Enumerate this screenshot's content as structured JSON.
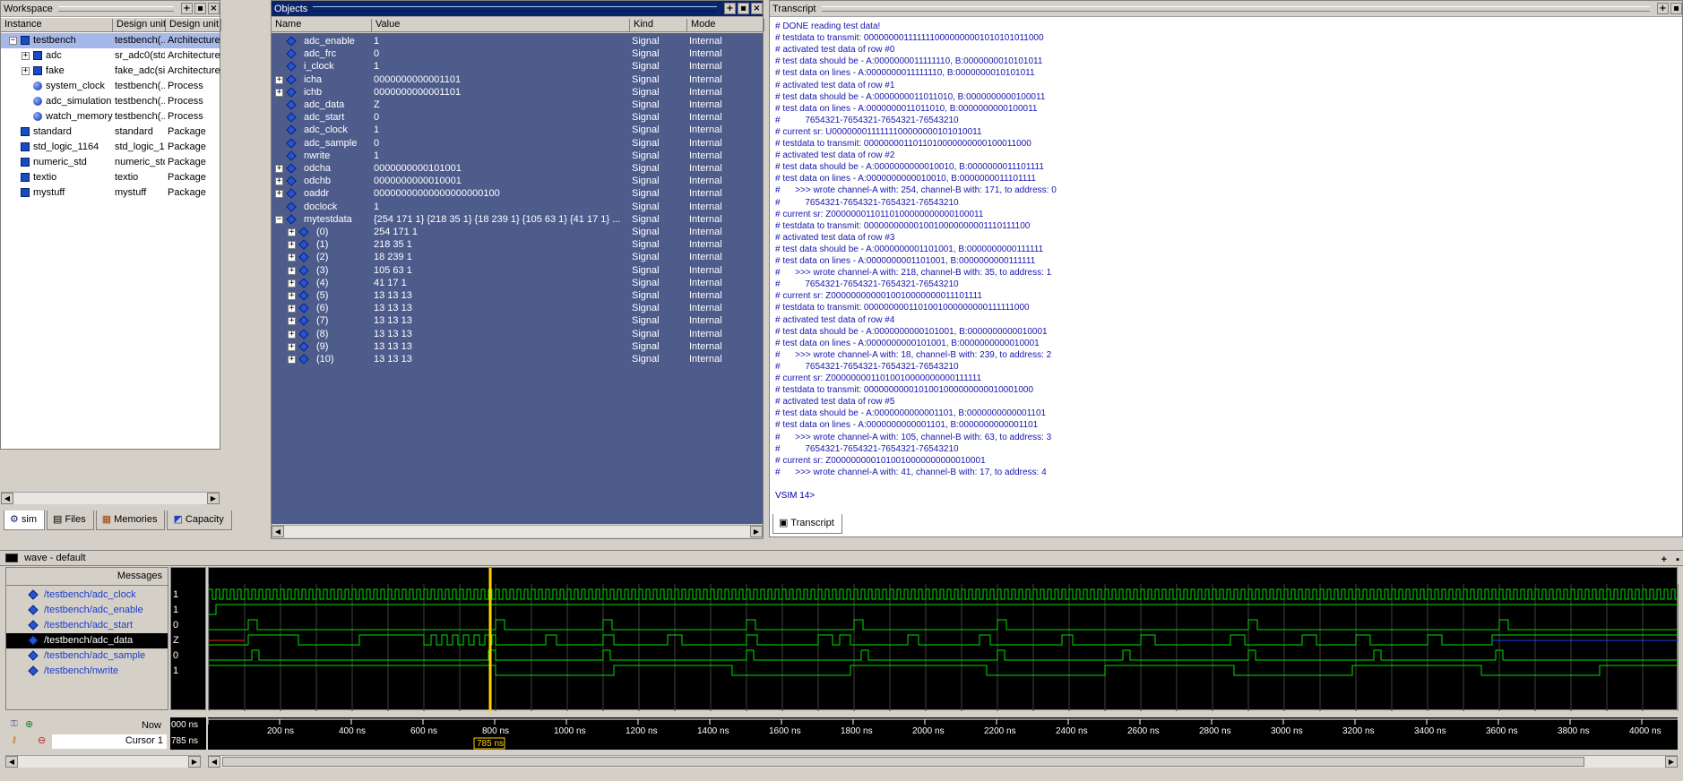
{
  "workspace": {
    "title": "Workspace",
    "columns": [
      "Instance",
      "Design unit",
      "Design unit ty"
    ],
    "rows": [
      {
        "name": "testbench",
        "unit": "testbench(...",
        "type": "Architecture",
        "level": 0,
        "expand": "-",
        "icon": "square"
      },
      {
        "name": "adc",
        "unit": "sr_adc0(std)",
        "type": "Architecture",
        "level": 1,
        "expand": "+",
        "icon": "square"
      },
      {
        "name": "fake",
        "unit": "fake_adc(si...",
        "type": "Architecture",
        "level": 1,
        "expand": "+",
        "icon": "square"
      },
      {
        "name": "system_clock",
        "unit": "testbench(...",
        "type": "Process",
        "level": 1,
        "expand": "",
        "icon": "ball"
      },
      {
        "name": "adc_simulation",
        "unit": "testbench(...",
        "type": "Process",
        "level": 1,
        "expand": "",
        "icon": "ball"
      },
      {
        "name": "watch_memory",
        "unit": "testbench(...",
        "type": "Process",
        "level": 1,
        "expand": "",
        "icon": "ball"
      },
      {
        "name": "standard",
        "unit": "standard",
        "type": "Package",
        "level": 0,
        "expand": "",
        "icon": "square"
      },
      {
        "name": "std_logic_1164",
        "unit": "std_logic_1...",
        "type": "Package",
        "level": 0,
        "expand": "",
        "icon": "square"
      },
      {
        "name": "numeric_std",
        "unit": "numeric_std",
        "type": "Package",
        "level": 0,
        "expand": "",
        "icon": "square"
      },
      {
        "name": "textio",
        "unit": "textio",
        "type": "Package",
        "level": 0,
        "expand": "",
        "icon": "square"
      },
      {
        "name": "mystuff",
        "unit": "mystuff",
        "type": "Package",
        "level": 0,
        "expand": "",
        "icon": "square"
      }
    ],
    "tabs": [
      "sim",
      "Files",
      "Memories",
      "Capacity"
    ]
  },
  "objects": {
    "title": "Objects",
    "columns": [
      "Name",
      "Value",
      "Kind",
      "Mode"
    ],
    "rows": [
      {
        "name": "adc_enable",
        "value": "1",
        "kind": "Signal",
        "mode": "Internal",
        "expand": "",
        "level": 0
      },
      {
        "name": "adc_frc",
        "value": "0",
        "kind": "Signal",
        "mode": "Internal",
        "expand": "",
        "level": 0
      },
      {
        "name": "i_clock",
        "value": "1",
        "kind": "Signal",
        "mode": "Internal",
        "expand": "",
        "level": 0
      },
      {
        "name": "icha",
        "value": "0000000000001101",
        "kind": "Signal",
        "mode": "Internal",
        "expand": "+",
        "level": 0
      },
      {
        "name": "ichb",
        "value": "0000000000001101",
        "kind": "Signal",
        "mode": "Internal",
        "expand": "+",
        "level": 0
      },
      {
        "name": "adc_data",
        "value": "Z",
        "kind": "Signal",
        "mode": "Internal",
        "expand": "",
        "level": 0
      },
      {
        "name": "adc_start",
        "value": "0",
        "kind": "Signal",
        "mode": "Internal",
        "expand": "",
        "level": 0
      },
      {
        "name": "adc_clock",
        "value": "1",
        "kind": "Signal",
        "mode": "Internal",
        "expand": "",
        "level": 0
      },
      {
        "name": "adc_sample",
        "value": "0",
        "kind": "Signal",
        "mode": "Internal",
        "expand": "",
        "level": 0
      },
      {
        "name": "nwrite",
        "value": "1",
        "kind": "Signal",
        "mode": "Internal",
        "expand": "",
        "level": 0
      },
      {
        "name": "odcha",
        "value": "0000000000101001",
        "kind": "Signal",
        "mode": "Internal",
        "expand": "+",
        "level": 0
      },
      {
        "name": "odchb",
        "value": "0000000000010001",
        "kind": "Signal",
        "mode": "Internal",
        "expand": "+",
        "level": 0
      },
      {
        "name": "oaddr",
        "value": "00000000000000000000100",
        "kind": "Signal",
        "mode": "Internal",
        "expand": "+",
        "level": 0
      },
      {
        "name": "doclock",
        "value": "1",
        "kind": "Signal",
        "mode": "Internal",
        "expand": "",
        "level": 0
      },
      {
        "name": "mytestdata",
        "value": "{254 171 1} {218 35 1} {18 239 1} {105 63 1} {41 17 1} ...",
        "kind": "Signal",
        "mode": "Internal",
        "expand": "-",
        "level": 0
      },
      {
        "name": "(0)",
        "value": "254 171 1",
        "kind": "Signal",
        "mode": "Internal",
        "expand": "+",
        "level": 1
      },
      {
        "name": "(1)",
        "value": "218 35 1",
        "kind": "Signal",
        "mode": "Internal",
        "expand": "+",
        "level": 1
      },
      {
        "name": "(2)",
        "value": "18 239 1",
        "kind": "Signal",
        "mode": "Internal",
        "expand": "+",
        "level": 1
      },
      {
        "name": "(3)",
        "value": "105 63 1",
        "kind": "Signal",
        "mode": "Internal",
        "expand": "+",
        "level": 1
      },
      {
        "name": "(4)",
        "value": "41 17 1",
        "kind": "Signal",
        "mode": "Internal",
        "expand": "+",
        "level": 1
      },
      {
        "name": "(5)",
        "value": "13 13 13",
        "kind": "Signal",
        "mode": "Internal",
        "expand": "+",
        "level": 1
      },
      {
        "name": "(6)",
        "value": "13 13 13",
        "kind": "Signal",
        "mode": "Internal",
        "expand": "+",
        "level": 1
      },
      {
        "name": "(7)",
        "value": "13 13 13",
        "kind": "Signal",
        "mode": "Internal",
        "expand": "+",
        "level": 1
      },
      {
        "name": "(8)",
        "value": "13 13 13",
        "kind": "Signal",
        "mode": "Internal",
        "expand": "+",
        "level": 1
      },
      {
        "name": "(9)",
        "value": "13 13 13",
        "kind": "Signal",
        "mode": "Internal",
        "expand": "+",
        "level": 1
      },
      {
        "name": "(10)",
        "value": "13 13 13",
        "kind": "Signal",
        "mode": "Internal",
        "expand": "+",
        "level": 1
      }
    ]
  },
  "transcript": {
    "title": "Transcript",
    "tab": "Transcript",
    "lines": [
      "# DONE reading test data!",
      "# testdata to transmit: 0000000011111110000000001010101011000",
      "# activated test data of row #0",
      "# test data should be - A:0000000011111110, B:0000000010101011",
      "# test data on lines - A:0000000011111110, B:0000000010101011",
      "# activated test data of row #1",
      "# test data should be - A:0000000011011010, B:0000000000100011",
      "# test data on lines - A:0000000011011010, B:0000000000100011",
      "#          7654321-7654321-7654321-76543210",
      "# current sr: U0000000111111100000000101010011",
      "# testdata to transmit: 0000000011011010000000000100011000",
      "# activated test data of row #2",
      "# test data should be - A:0000000000010010, B:0000000011101111",
      "# test data on lines - A:0000000000010010, B:0000000011101111",
      "#      >>> wrote channel-A with: 254, channel-B with: 171, to address: 0",
      "#          7654321-7654321-7654321-76543210",
      "# current sr: Z0000000110110100000000000100011",
      "# testdata to transmit: 0000000000010010000000001110111100",
      "# activated test data of row #3",
      "# test data should be - A:0000000001101001, B:0000000000111111",
      "# test data on lines - A:0000000001101001, B:0000000000111111",
      "#      >>> wrote channel-A with: 218, channel-B with: 35, to address: 1",
      "#          7654321-7654321-7654321-76543210",
      "# current sr: Z0000000000010010000000011101111",
      "# testdata to transmit: 0000000001101001000000000111111000",
      "# activated test data of row #4",
      "# test data should be - A:0000000000101001, B:0000000000010001",
      "# test data on lines - A:0000000000101001, B:0000000000010001",
      "#      >>> wrote channel-A with: 18, channel-B with: 239, to address: 2",
      "#          7654321-7654321-7654321-76543210",
      "# current sr: Z0000000011010010000000000111111",
      "# testdata to transmit: 0000000000101001000000000010001000",
      "# activated test data of row #5",
      "# test data should be - A:0000000000001101, B:0000000000001101",
      "# test data on lines - A:0000000000001101, B:0000000000001101",
      "#      >>> wrote channel-A with: 105, channel-B with: 63, to address: 3",
      "#          7654321-7654321-7654321-76543210",
      "# current sr: Z0000000001010010000000000010001",
      "#      >>> wrote channel-A with: 41, channel-B with: 17, to address: 4",
      "",
      "VSIM 14>"
    ]
  },
  "wave": {
    "title": "wave - default",
    "messages_label": "Messages",
    "signals": [
      {
        "name": "/testbench/adc_clock",
        "value": "1"
      },
      {
        "name": "/testbench/adc_enable",
        "value": "1"
      },
      {
        "name": "/testbench/adc_start",
        "value": "0"
      },
      {
        "name": "/testbench/adc_data",
        "value": "Z"
      },
      {
        "name": "/testbench/adc_sample",
        "value": "0"
      },
      {
        "name": "/testbench/nwrite",
        "value": "1"
      }
    ],
    "now_label": "Now",
    "now_value": "000 ns",
    "cursor_label": "Cursor 1",
    "cursor_value": "785 ns",
    "cursor_time_ns": 785,
    "time_start_ns": 0,
    "time_end_ns": 4100,
    "time_ticks": [
      "ns",
      "200 ns",
      "400 ns",
      "600 ns",
      "800 ns",
      "1000 ns",
      "1200 ns",
      "1400 ns",
      "1600 ns",
      "1800 ns",
      "2000 ns",
      "2200 ns",
      "2400 ns",
      "2600 ns",
      "2800 ns",
      "3000 ns",
      "3200 ns",
      "3400 ns",
      "3600 ns",
      "3800 ns",
      "4000 ns"
    ],
    "colors": {
      "signal": "#00e000",
      "cursor": "#ffd200",
      "highz": "#2040ff",
      "grid": "#404040"
    }
  }
}
